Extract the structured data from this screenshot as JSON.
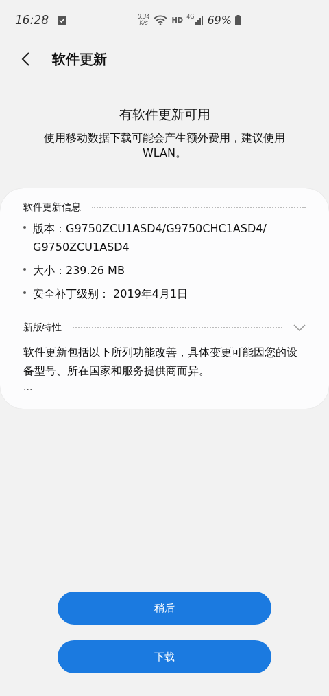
{
  "status_bar": {
    "time": "16:28",
    "speed": "0.34\nK/s",
    "network": "HD",
    "generation": "4G",
    "battery": "69%"
  },
  "header": {
    "title": "软件更新"
  },
  "intro": {
    "title": "有软件更新可用",
    "message": "使用移动数据下载可能会产生额外费用，建议使用 WLAN。"
  },
  "info": {
    "heading": "软件更新信息",
    "items": [
      "版本：G9750ZCU1ASD4/G9750CHC1ASD4/\nG9750ZCU1ASD4",
      "大小：239.26 MB",
      "安全补丁级别： 2019年4月1日"
    ]
  },
  "features": {
    "heading": "新版特性",
    "expanded": false,
    "text": "软件更新包括以下所列功能改善，具体变更可能因您的设备型号、所在国家和服务提供商而异。",
    "more": "..."
  },
  "buttons": [
    "稍后",
    "下载"
  ]
}
